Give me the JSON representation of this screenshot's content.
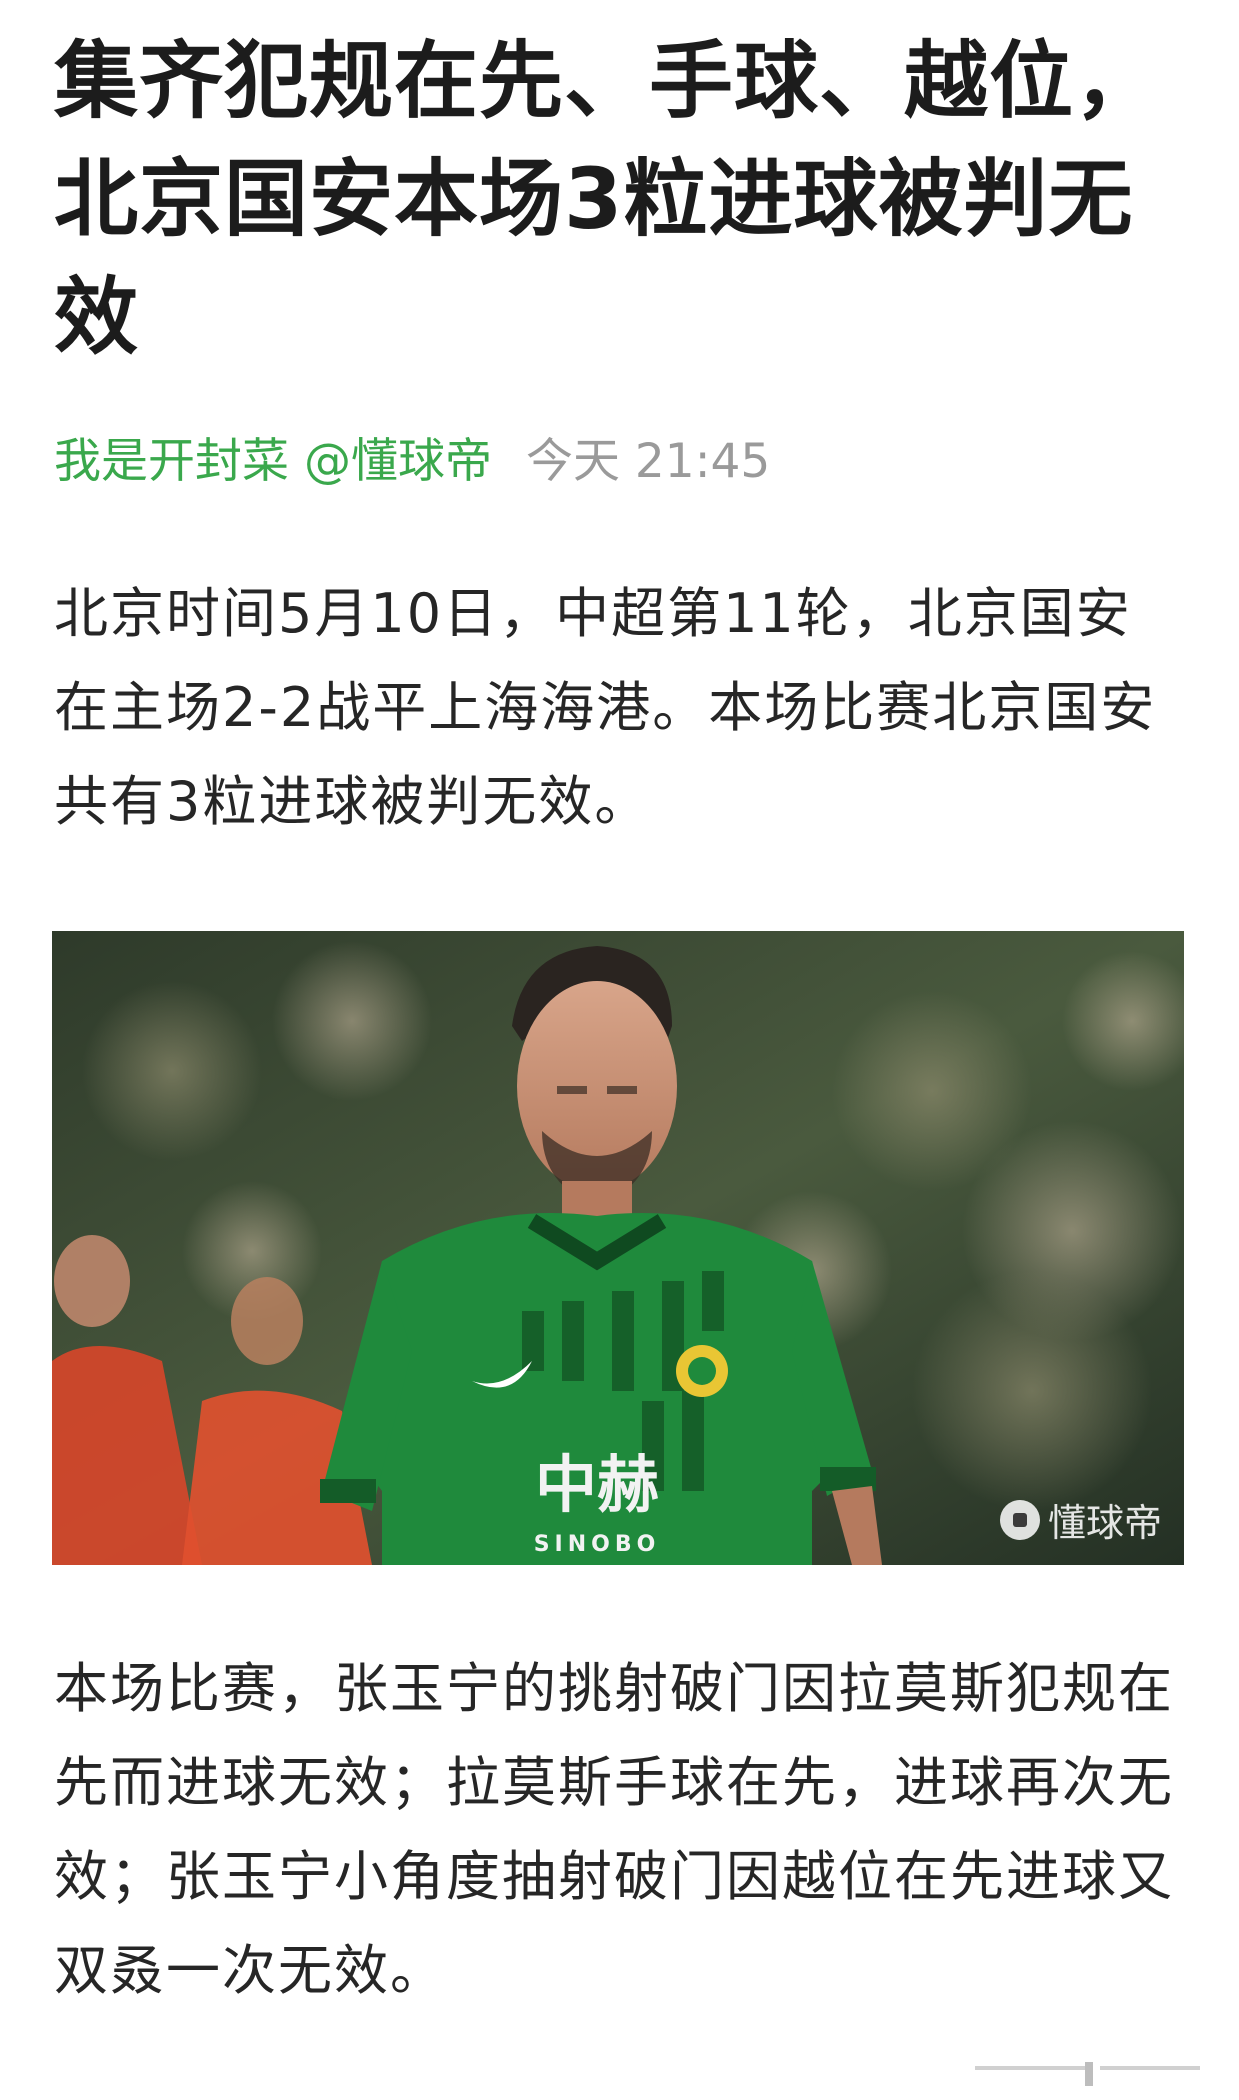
{
  "article": {
    "title": "集齐犯规在先、手球、越位，北京国安本场3粒进球被判无效",
    "author": "我是开封菜 @懂球帝",
    "time": "今天 21:45",
    "paragraphs": [
      "北京时间5月10日，中超第11轮，北京国安在主场2-2战平上海海港。本场比赛北京国安共有3粒进球被判无效。",
      "本场比赛，张玉宁的挑射破门因拉莫斯犯规在先而进球无效；拉莫斯手球在先，进球再次无效；张玉宁小角度抽射破门因越位在先进球又双叒一次无效。"
    ]
  },
  "photo": {
    "shirt_sponsor": "中赫",
    "shirt_sponsor_en": "SINOBO",
    "watermark": "懂球帝",
    "icon": "football-icon"
  },
  "colors": {
    "author": "#3aa84c",
    "time": "#9a9a9a",
    "jersey": "#1f8a3c"
  }
}
